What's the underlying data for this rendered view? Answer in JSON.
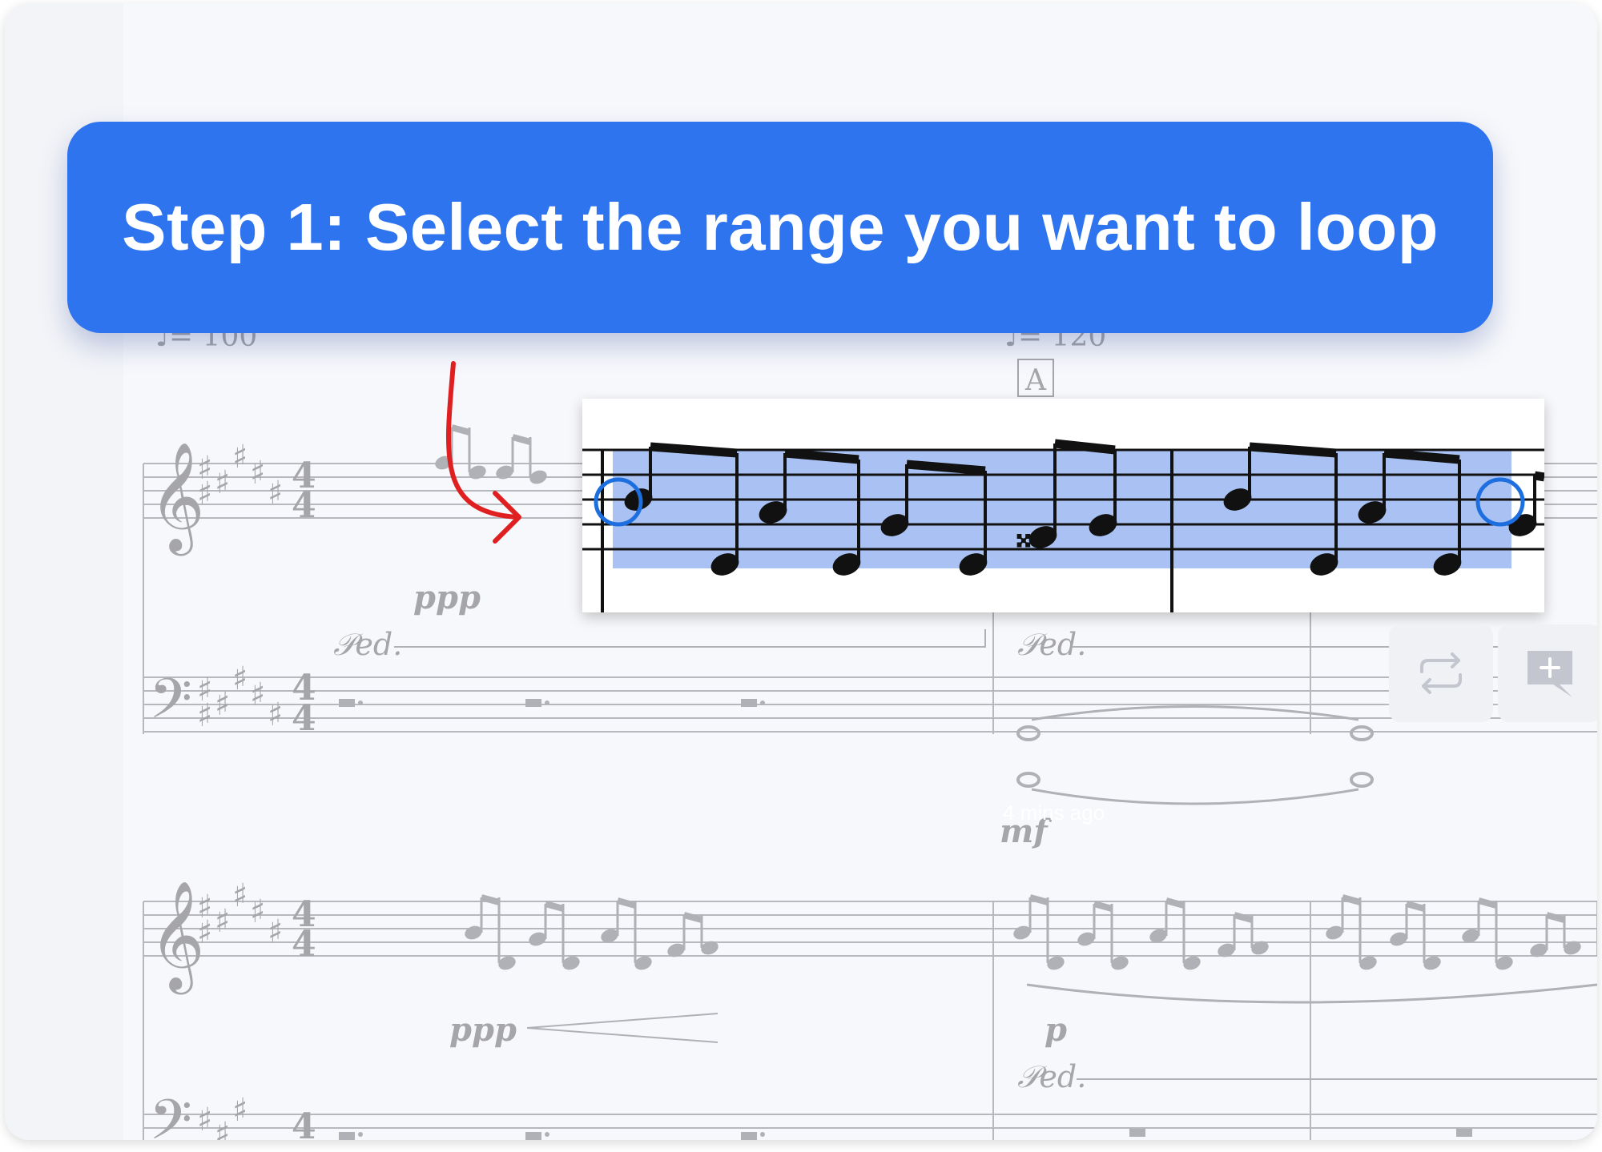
{
  "callout": {
    "text": "Step 1: Select the range you want to loop",
    "background": "#2f74ef"
  },
  "score": {
    "tempo_marks": [
      "♩= 100",
      "♩= 120"
    ],
    "rehearsal_mark": "A",
    "dynamics": [
      "ppp",
      "ppp",
      "mf",
      "p"
    ],
    "pedal_text": [
      "𝒫ed.",
      "𝒫ed.",
      "𝒫ed."
    ],
    "key_signature": "6 sharps (F♯ major)",
    "time_signature": "4/4"
  },
  "selection": {
    "highlight_color": "#a9c2f3",
    "handle_color": "#1d6fe0",
    "annotation_arrow_color": "#e02020"
  },
  "toolbar": {
    "loop_icon": "loop-icon",
    "add_comment_icon": "add-comment-icon"
  },
  "timestamp": "4 mins ago"
}
